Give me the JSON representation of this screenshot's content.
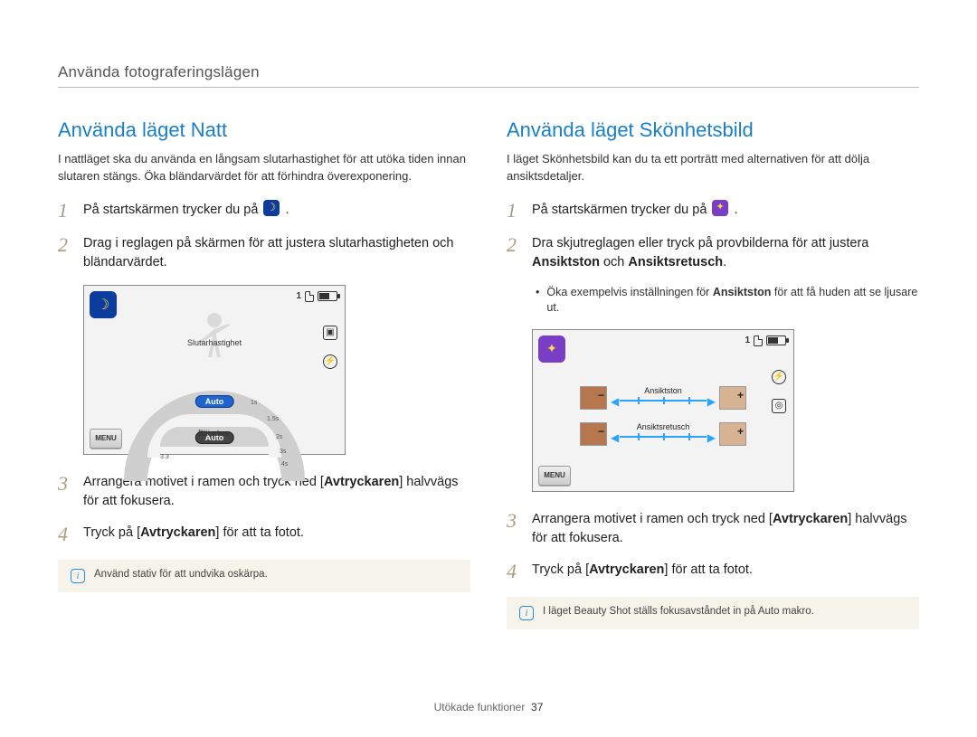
{
  "chapter": "Använda fotograferingslägen",
  "left": {
    "heading": "Använda läget Natt",
    "intro": "I nattläget ska du använda en långsam slutarhastighet för att utöka tiden innan slutaren stängs. Öka bländarvärdet för att förhindra överexponering.",
    "step1_pre": "På startskärmen trycker du på ",
    "step1_post": ".",
    "step2": "Drag i reglagen på skärmen för att justera slutarhastigheten och bländarvärdet.",
    "step3_a": "Arrangera motivet i ramen och tryck ned [",
    "step3_b": "Avtryckaren",
    "step3_c": "] halvvägs för att fokusera.",
    "step4_a": "Tryck på [",
    "step4_b": "Avtryckaren",
    "step4_c": "] för att ta fotot.",
    "tip": "Använd stativ för att undvika oskärpa.",
    "screen": {
      "counter": "1",
      "menu": "MENU",
      "shutter_label": "Slutarhastighet",
      "aperture_label": "Bländare",
      "auto_top": "Auto",
      "auto_bot": "Auto",
      "ticks": [
        "1s",
        "1.5s",
        "2s",
        "3s",
        "4s",
        "3.3"
      ]
    }
  },
  "right": {
    "heading": "Använda läget Skönhetsbild",
    "intro": "I läget Skönhetsbild kan du ta ett porträtt med alternativen för att dölja ansiktsdetaljer.",
    "step1_pre": "På startskärmen trycker du på ",
    "step1_post": ".",
    "step2_a": "Dra skjutreglagen eller tryck på provbilderna för att justera ",
    "step2_b": "Ansiktston",
    "step2_c": " och ",
    "step2_d": "Ansiktsretusch",
    "step2_e": ".",
    "bullet_a": "Öka exempelvis inställningen för ",
    "bullet_b": "Ansiktston",
    "bullet_c": " för att få huden att se ljusare ut.",
    "step3_a": "Arrangera motivet i ramen och tryck ned [",
    "step3_b": "Avtryckaren",
    "step3_c": "] halvvägs för att fokusera.",
    "step4_a": "Tryck på [",
    "step4_b": "Avtryckaren",
    "step4_c": "] för att ta fotot.",
    "tip": "I läget Beauty Shot ställs fokusavståndet in på Auto makro.",
    "screen": {
      "counter": "1",
      "menu": "MENU",
      "slider1": "Ansiktston",
      "slider2": "Ansiktsretusch"
    }
  },
  "footer": {
    "section": "Utökade funktioner",
    "page": "37"
  }
}
